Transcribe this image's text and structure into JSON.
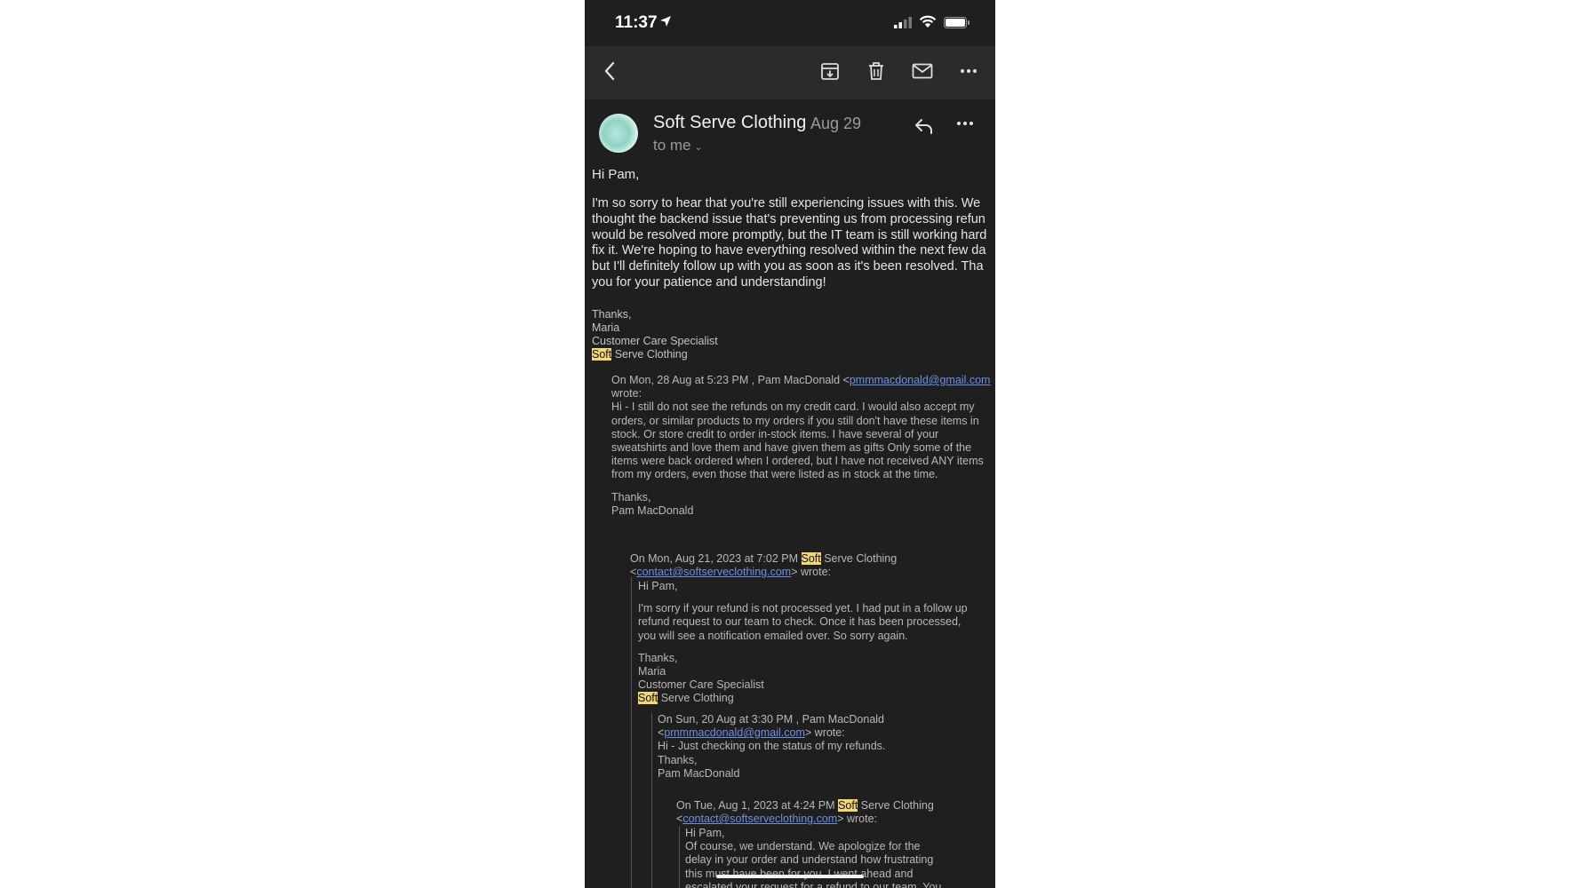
{
  "status_bar": {
    "time": "11:37"
  },
  "toolbar": {
    "icons": [
      "back-chevron-icon",
      "archive-icon",
      "trash-icon",
      "mail-icon",
      "more-icon"
    ]
  },
  "header": {
    "sender": "Soft Serve Clothing",
    "date": "Aug 29",
    "recipient": "to me"
  },
  "message": {
    "greeting": "Hi Pam,",
    "lines": [
      "I'm so sorry to hear that you're still experiencing issues with this. We",
      "thought the backend issue that's preventing us from processing refun",
      "would be resolved more promptly, but the IT team is still working hard",
      "fix it. We're hoping to have everything resolved within the next few da",
      "but I'll definitely follow up with you as soon as it's been resolved. Tha",
      "you for your patience and understanding!"
    ],
    "signature": {
      "thanks": "Thanks,",
      "name": "Maria",
      "title": "Customer Care Specialist",
      "company_hl": "Soft",
      "company_rest": " Serve Clothing"
    }
  },
  "quote1": {
    "header_prefix": "On Mon, 28 Aug at 5:23 PM , Pam MacDonald <",
    "email": "pmmmacdonald@gmail.com",
    "wrote": "wrote:",
    "lines": [
      "Hi - I still do not see the refunds on my credit card. I would also accept my",
      "orders, or similar products to my orders if you still don't have these items in",
      "stock. Or store credit to order in-stock items. I have several of your",
      "sweatshirts and love them and have given them as gifts  Only some of the",
      "items were back ordered when I ordered, but I have not received ANY items",
      "from my orders, even those that were listed as in stock at the time."
    ],
    "thanks": "Thanks,",
    "name": "Pam MacDonald"
  },
  "quote2": {
    "header_prefix": "On Mon, Aug 21, 2023 at 7:02 PM ",
    "header_hl": "Soft",
    "header_rest": " Serve Clothing",
    "email_open": "<",
    "email": "contact@softserveclothing.com",
    "email_close": "> wrote:",
    "greeting": "Hi Pam,",
    "lines": [
      "I'm sorry if your refund is not processed yet. I had put in a follow up",
      "refund request to our team to check. Once it has been processed,",
      "you will see a notification emailed over. So sorry again."
    ],
    "thanks": "Thanks,",
    "name": "Maria",
    "title": "Customer Care Specialist",
    "company_hl": "Soft",
    "company_rest": " Serve Clothing"
  },
  "quote3": {
    "header": "On Sun, 20 Aug at 3:30 PM , Pam MacDonald",
    "email_open": "<",
    "email": "pmmmacdonald@gmail.com",
    "email_close": "> wrote:",
    "body": "Hi - Just checking on the status of my refunds.",
    "thanks": "Thanks,",
    "name": "Pam MacDonald"
  },
  "quote4": {
    "header_prefix": "On Tue, Aug 1, 2023 at 4:24 PM ",
    "header_hl": "Soft",
    "header_rest": " Serve Clothing",
    "email_open": "<",
    "email": "contact@softserveclothing.com",
    "email_close": "> wrote:",
    "greeting": "Hi Pam,",
    "lines": [
      "Of course, we understand. We apologize for the",
      "delay in your order and understand how frustrating",
      "this must have been for you. I went ahead and",
      "escalated your request for a refund to our team. You"
    ]
  }
}
